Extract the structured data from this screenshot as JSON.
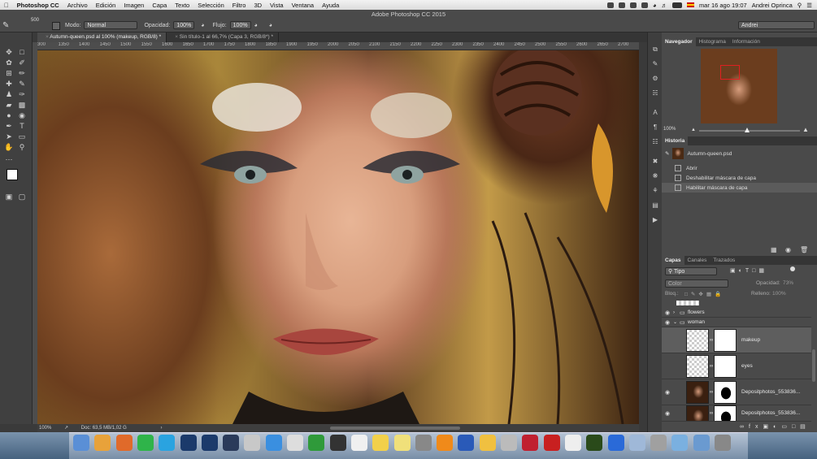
{
  "menubar": {
    "app": "Photoshop CC",
    "items": [
      "Archivo",
      "Edición",
      "Imagen",
      "Capa",
      "Texto",
      "Selección",
      "Filtro",
      "3D",
      "Vista",
      "Ventana",
      "Ayuda"
    ],
    "datetime": "mar 16 ago  19:07",
    "user": "Andrei Oprinca"
  },
  "window_title": "Adobe Photoshop CC 2015",
  "options": {
    "zoom_label": "500",
    "mode_label": "Modo:",
    "mode_value": "Normal",
    "opacity_label": "Opacidad:",
    "opacity_value": "100%",
    "flow_label": "Flujo:",
    "flow_value": "100%",
    "workspace": "Andrei"
  },
  "tabs": [
    {
      "label": "Autumn-queen.psd al 100% (makeup, RGB/8) *",
      "active": true
    },
    {
      "label": "Sin título-1 al 66,7% (Capa 3, RGB/8*) *",
      "active": false
    }
  ],
  "ruler_ticks": [
    "300",
    "1350",
    "1400",
    "1450",
    "1500",
    "1550",
    "1600",
    "1650",
    "1700",
    "1750",
    "1800",
    "1850",
    "1900",
    "1950",
    "2000",
    "2050",
    "2100",
    "2150",
    "2200",
    "2250",
    "2300",
    "2350",
    "2400",
    "2450",
    "2500",
    "2550",
    "2600",
    "2650",
    "2700"
  ],
  "status": {
    "zoom": "100%",
    "doc": "Doc: 63,5 MB/1,02 G"
  },
  "navigator": {
    "tabs": [
      "Navegador",
      "Histograma",
      "Información"
    ],
    "zoom": "100%"
  },
  "history": {
    "title": "Historia",
    "snapshot": "Autumn-queen.psd",
    "items": [
      "Abrir",
      "Deshabilitar máscara de capa",
      "Habilitar máscara de capa"
    ],
    "selected_index": 2
  },
  "layers": {
    "tabs": [
      "Capas",
      "Canales",
      "Trazados"
    ],
    "filter_label": "Tipo",
    "blend_mode": "Color",
    "opacity_label": "Opacidad:",
    "opacity_value": "73%",
    "lock_label": "Bloq.:",
    "fill_label": "Relleno:",
    "fill_value": "100%",
    "items": [
      {
        "name": "flowers",
        "type": "group"
      },
      {
        "name": "woman",
        "type": "group"
      },
      {
        "name": "makeup",
        "type": "layer"
      },
      {
        "name": "eyes",
        "type": "layer"
      },
      {
        "name": "Depositphotos_553836...",
        "type": "layer"
      },
      {
        "name": "Depositphotos_553836...",
        "type": "layer"
      }
    ]
  },
  "dock": [
    "Finder",
    "Chrome",
    "Firefox",
    "Spotify",
    "Skype",
    "Ps",
    "Ps",
    "Lr",
    "Preview",
    "Safari",
    "Script",
    "Camtasia",
    "Activity",
    "Calendar",
    "Notes",
    "Stickies",
    "Disk",
    "VLC",
    "Word",
    "Photos",
    "Files",
    "Maps",
    "FileZilla",
    "TextEdit",
    "Dw",
    "Earth",
    "Downloads",
    "Help",
    "Photo",
    "Folder",
    "Trash"
  ],
  "colors": {
    "accent_red": "#e02020",
    "panel_bg": "#4a4a4a",
    "toolbar_bg": "#404040"
  }
}
